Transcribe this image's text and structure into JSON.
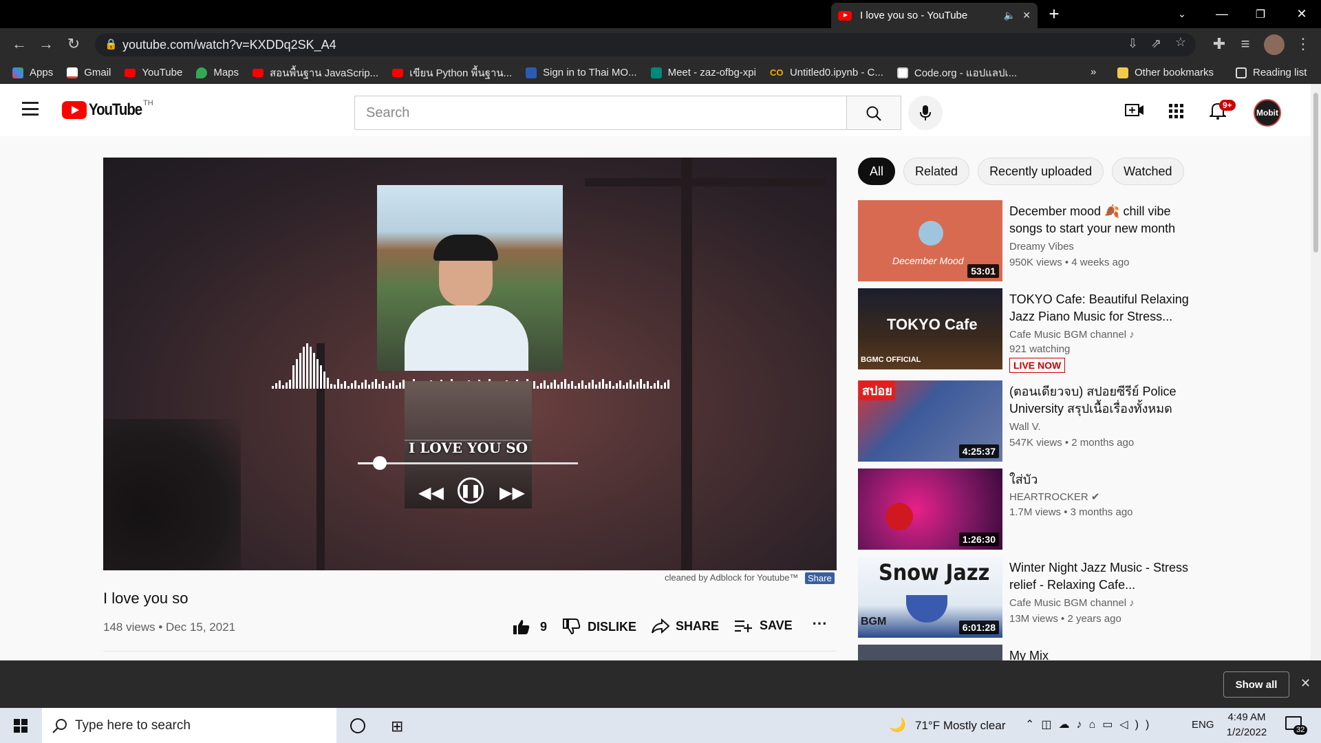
{
  "browser": {
    "tab_title": "I love you so - YouTube",
    "url": "youtube.com/watch?v=KXDDq2SK_A4",
    "bookmarks": [
      "Apps",
      "Gmail",
      "YouTube",
      "Maps",
      "สอนพื้นฐาน JavaScrip...",
      "เขียน Python พื้นฐาน...",
      "Sign in to Thai MO...",
      "Meet - zaz-ofbg-xpi",
      "Untitled0.ipynb - C...",
      "Code.org - แอปแลปเ..."
    ],
    "other_bookmarks": "Other bookmarks",
    "reading_list": "Reading list",
    "overflow": "»"
  },
  "youtube": {
    "logo_text": "YouTube",
    "region": "TH",
    "search_placeholder": "Search",
    "notif_count": "9+",
    "avatar_text": "Mobit"
  },
  "player": {
    "overlay_title": "I LOVE YOU SO",
    "progress": 0.1
  },
  "adblock": {
    "note": "cleaned by Adblock for Youtube™",
    "share": "Share"
  },
  "video": {
    "title": "I love you so",
    "meta": "148 views • Dec 15, 2021",
    "likes": "9",
    "dislike": "DISLIKE",
    "share": "SHARE",
    "save": "SAVE"
  },
  "chips": [
    "All",
    "Related",
    "Recently uploaded",
    "Watched"
  ],
  "recommendations": [
    {
      "title": "December mood 🍂 chill vibe songs to start your new month",
      "channel": "Dreamy Vibes",
      "meta": "950K views • 4 weeks ago",
      "duration": "53:01",
      "thumb_text": "December Mood",
      "color": "#d86a52"
    },
    {
      "title": "TOKYO Cafe: Beautiful Relaxing Jazz Piano Music for Stress...",
      "channel": "Cafe Music BGM channel ♪",
      "meta": "921 watching",
      "live": "LIVE NOW",
      "thumb_text": "TOKYO Cafe",
      "thumb_sub": "BGMC OFFICIAL",
      "color": "#3a2a1e"
    },
    {
      "title": "(ตอนเดียวจบ) สปอยซีรีย์ Police University สรุปเนื้อเรื่องทั้งหมด E...",
      "channel": "Wall V.",
      "meta": "547K views • 2 months ago",
      "duration": "4:25:37",
      "thumb_text": "สปอย",
      "color": "#3d5a9a"
    },
    {
      "title": "ใส่บัว",
      "channel": "HEARTROCKER ✔",
      "meta": "1.7M views • 3 months ago",
      "duration": "1:26:30",
      "color": "#7a1a6a"
    },
    {
      "title": "Winter Night Jazz Music - Stress relief - Relaxing Cafe...",
      "channel": "Cafe Music BGM channel ♪",
      "meta": "13M views • 2 years ago",
      "duration": "6:01:28",
      "thumb_text": "Snow Jazz",
      "thumb_sub": "BGM",
      "color": "#dfe8f2"
    },
    {
      "title": "My Mix",
      "color": "#4a5060"
    }
  ],
  "downloads": {
    "show_all": "Show all"
  },
  "taskbar": {
    "search_placeholder": "Type here to search",
    "weather": "71°F  Mostly clear",
    "lang": "ENG",
    "time": "4:49 AM",
    "date": "1/2/2022",
    "notif": "32"
  }
}
